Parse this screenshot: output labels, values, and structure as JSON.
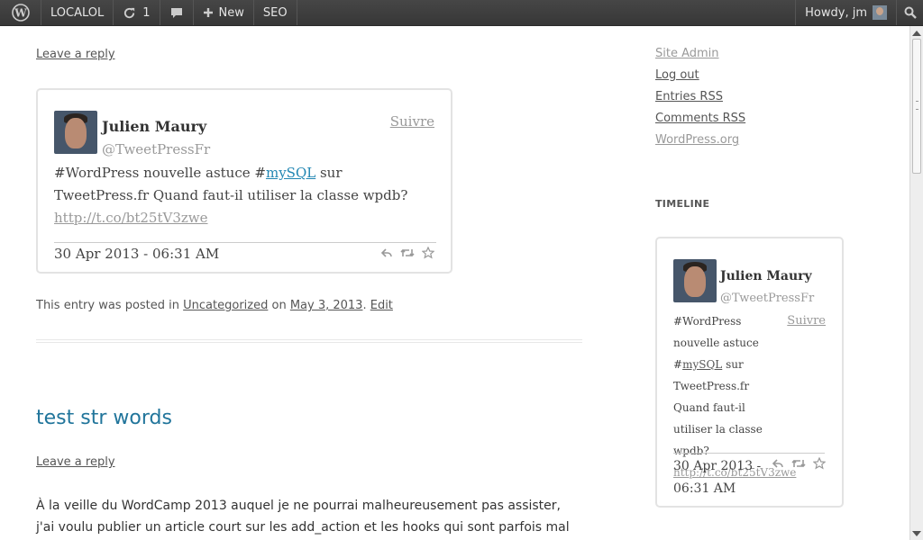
{
  "adminbar": {
    "site_name": "LOCALOL",
    "updates_count": "1",
    "new_label": "New",
    "seo_label": "SEO",
    "howdy": "Howdy, jm"
  },
  "post1": {
    "reply_link": "Leave a reply",
    "tweet": {
      "name": "Julien Maury",
      "handle": "@TweetPressFr",
      "follow": "Suivre",
      "text_pre": "#WordPress nouvelle astuce #",
      "hashtag": "mySQL",
      "text_post": " sur TweetPress.fr Quand faut-il utiliser la classe wpdb? ",
      "url": "http://t.co/bt25tV3zwe",
      "date": "30 Apr 2013 - 06:31 AM"
    },
    "meta": {
      "posted_in": "This entry was posted in ",
      "category": "Uncategorized",
      "on": " on ",
      "date": "May 3, 2013",
      "sep": ". ",
      "edit": "Edit"
    }
  },
  "post2": {
    "title": "test str words",
    "reply_link": "Leave a reply",
    "body": "À la veille du WordCamp 2013 auquel je ne pourrai malheureusement pas assister, j'ai voulu publier un article court sur les add_action et les hooks qui sont parfois mal"
  },
  "sidebar": {
    "meta_links": [
      "Site Admin",
      "Log out",
      "Entries RSS",
      "Comments RSS",
      "WordPress.org"
    ],
    "widget_title": "TIMELINE",
    "tweet": {
      "name": "Julien Maury",
      "handle": "@TweetPressFr",
      "follow": "Suivre",
      "text_pre": "#WordPress nouvelle astuce #",
      "hashtag": "mySQL",
      "text_post": " sur TweetPress.fr Quand faut-il utiliser la classe wpdb? ",
      "url": "http://t.co/bt25tV3zwe",
      "date": "30 Apr 2013 - 06:31 AM"
    }
  }
}
